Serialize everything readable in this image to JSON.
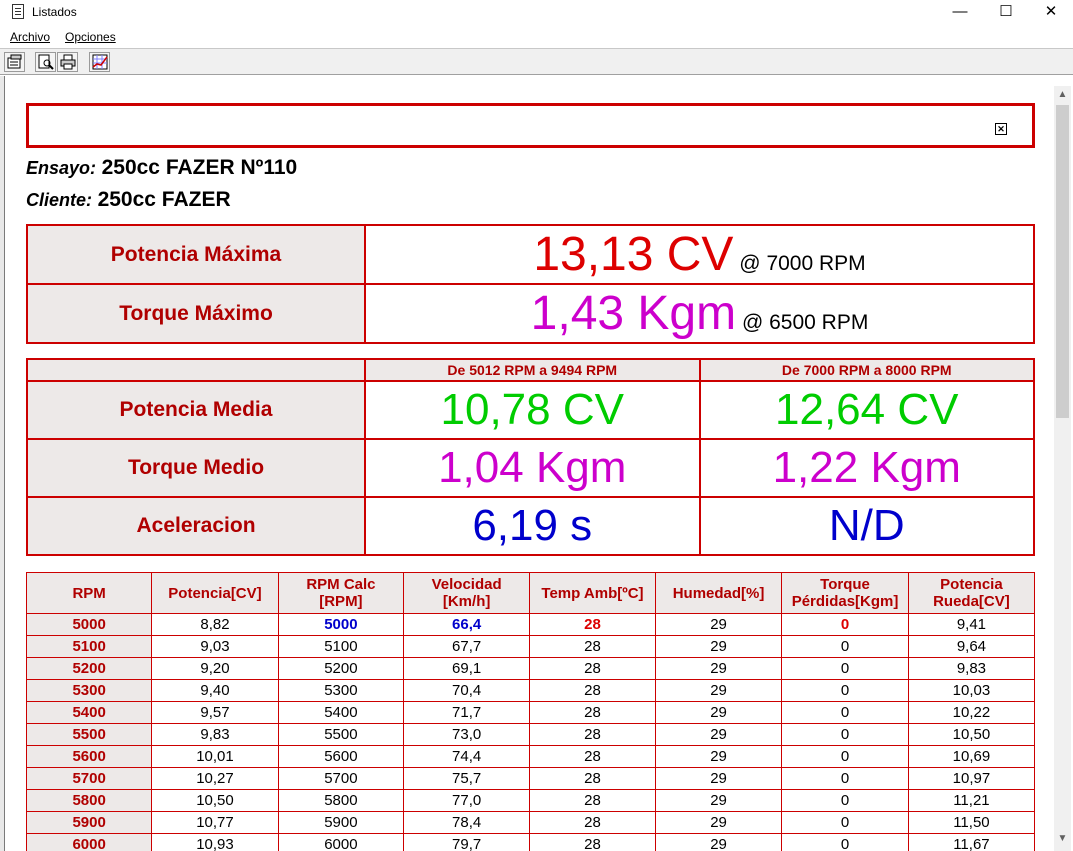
{
  "window": {
    "title": "Listados",
    "minimize": "—",
    "maximize": "☐",
    "close": "✕"
  },
  "menu": {
    "archivo": "Archivo",
    "opciones": "Opciones"
  },
  "report": {
    "close_mark": "✕",
    "ensayo_label": "Ensayo:",
    "ensayo_value": "250cc FAZER Nº110",
    "cliente_label": "Cliente:",
    "cliente_value": "250cc FAZER"
  },
  "maximos": {
    "potencia_label": "Potencia Máxima",
    "potencia_value": "13,13 CV",
    "potencia_rpm": " @ 7000 RPM",
    "torque_label": "Torque Máximo",
    "torque_value": "1,43 Kgm",
    "torque_rpm": " @ 6500 RPM"
  },
  "medios": {
    "range1": "De 5012 RPM a 9494 RPM",
    "range2": "De 7000 RPM a 8000 RPM",
    "potencia_label": "Potencia Media",
    "potencia_v1": "10,78 CV",
    "potencia_v2": "12,64 CV",
    "torque_label": "Torque Medio",
    "torque_v1": "1,04 Kgm",
    "torque_v2": "1,22 Kgm",
    "acel_label": "Aceleracion",
    "acel_v1": "6,19 s",
    "acel_v2": "N/D"
  },
  "colors": {
    "red": "#dd0000",
    "magenta": "#cc00cc",
    "green": "#00cc00",
    "blue": "#0000cc"
  },
  "table": {
    "headers": [
      "RPM",
      "Potencia[CV]",
      "RPM Calc\n[RPM]",
      "Velocidad\n[Km/h]",
      "Temp Amb[ºC]",
      "Humedad[%]",
      "Torque\nPérdidas[Kgm]",
      "Potencia\nRueda[CV]"
    ],
    "rows": [
      [
        "5000",
        "8,82",
        "5000",
        "66,4",
        "28",
        "29",
        "0",
        "9,41"
      ],
      [
        "5100",
        "9,03",
        "5100",
        "67,7",
        "28",
        "29",
        "0",
        "9,64"
      ],
      [
        "5200",
        "9,20",
        "5200",
        "69,1",
        "28",
        "29",
        "0",
        "9,83"
      ],
      [
        "5300",
        "9,40",
        "5300",
        "70,4",
        "28",
        "29",
        "0",
        "10,03"
      ],
      [
        "5400",
        "9,57",
        "5400",
        "71,7",
        "28",
        "29",
        "0",
        "10,22"
      ],
      [
        "5500",
        "9,83",
        "5500",
        "73,0",
        "28",
        "29",
        "0",
        "10,50"
      ],
      [
        "5600",
        "10,01",
        "5600",
        "74,4",
        "28",
        "29",
        "0",
        "10,69"
      ],
      [
        "5700",
        "10,27",
        "5700",
        "75,7",
        "28",
        "29",
        "0",
        "10,97"
      ],
      [
        "5800",
        "10,50",
        "5800",
        "77,0",
        "28",
        "29",
        "0",
        "11,21"
      ],
      [
        "5900",
        "10,77",
        "5900",
        "78,4",
        "28",
        "29",
        "0",
        "11,50"
      ],
      [
        "6000",
        "10,93",
        "6000",
        "79,7",
        "28",
        "29",
        "0",
        "11,67"
      ]
    ]
  }
}
